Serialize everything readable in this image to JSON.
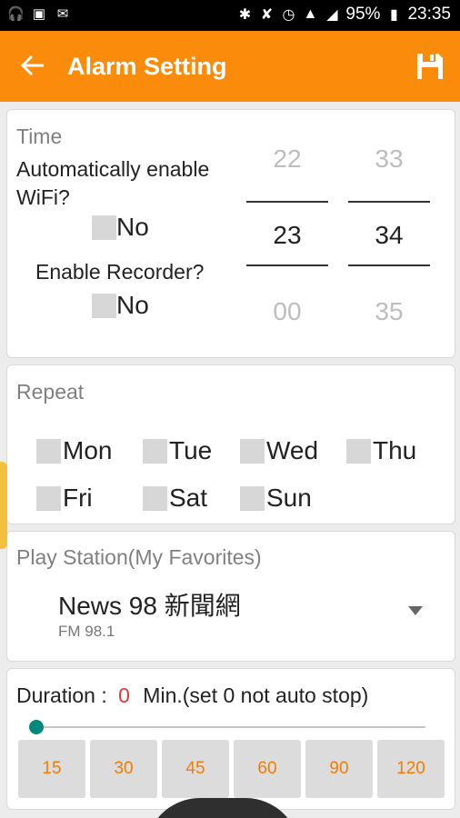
{
  "status": {
    "battery": "95%",
    "time": "23:35"
  },
  "appbar": {
    "title": "Alarm Setting"
  },
  "time_card": {
    "label": "Time",
    "wifi_label": "Automatically enable WiFi?",
    "wifi_value": "No",
    "recorder_label": "Enable Recorder?",
    "recorder_value": "No",
    "hour_prev": "22",
    "hour_current": "23",
    "hour_next": "00",
    "minute_prev": "33",
    "minute_current": "34",
    "minute_next": "35"
  },
  "repeat_card": {
    "label": "Repeat",
    "days": [
      "Mon",
      "Tue",
      "Wed",
      "Thu",
      "Fri",
      "Sat",
      "Sun"
    ]
  },
  "station_card": {
    "label": "Play Station(My Favorites)",
    "station_name": "News 98 新聞網",
    "station_freq": "FM 98.1"
  },
  "duration_card": {
    "label": "Duration :",
    "value": "0",
    "unit_note": "Min.(set 0 not auto stop)",
    "slider_fraction": 0,
    "presets": [
      "15",
      "30",
      "45",
      "60",
      "90",
      "120"
    ]
  },
  "colors": {
    "accent": "#fb8c0b",
    "duration_value": "#e53935",
    "slider_thumb": "#00897b"
  }
}
